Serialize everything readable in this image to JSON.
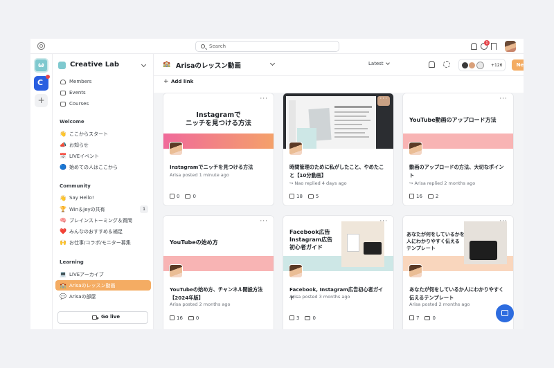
{
  "search": {
    "placeholder": "Search"
  },
  "notifications": {
    "badge": "1"
  },
  "community": {
    "name": "Creative Lab"
  },
  "sidebar": {
    "top_items": [
      {
        "label": "Members",
        "icon": "members-icon"
      },
      {
        "label": "Events",
        "icon": "calendar-icon"
      },
      {
        "label": "Courses",
        "icon": "book-icon"
      }
    ],
    "sections": [
      {
        "title": "Welcome",
        "items": [
          {
            "emoji": "👋",
            "label": "ここからスタート"
          },
          {
            "emoji": "📣",
            "label": "お知らせ"
          },
          {
            "emoji": "📅",
            "label": "LIVEイベント"
          },
          {
            "emoji": "🔵",
            "label": "始めての人はここから"
          }
        ]
      },
      {
        "title": "Community",
        "items": [
          {
            "emoji": "👋",
            "label": "Say Hello!"
          },
          {
            "emoji": "🏆",
            "label": "Win＆Jeyの共有",
            "count": "1"
          },
          {
            "emoji": "🧠",
            "label": "ブレインストーミング＆質問"
          },
          {
            "emoji": "❤️",
            "label": "みんなのおすすめ＆補足"
          },
          {
            "emoji": "🙌",
            "label": "お仕事/コラボ/モニター募集"
          }
        ]
      },
      {
        "title": "Learning",
        "items": [
          {
            "emoji": "💻",
            "label": "LIVEアーカイブ"
          },
          {
            "emoji": "🏫",
            "label": "Arisaのレッスン動画",
            "active": true
          },
          {
            "emoji": "💬",
            "label": "Arisaの部屋"
          }
        ]
      }
    ],
    "go_live": "Go live"
  },
  "main": {
    "space_emoji": "🏫",
    "space_title": "Arisaのレッスン動画",
    "sort": "Latest",
    "member_count": "+126",
    "new_post": "New post",
    "add_link": "Add link"
  },
  "posts": [
    {
      "cover_text": "Instagramで\nニッチを見つける方法",
      "title": "Instagramでニッチを見つける方法",
      "meta": "Arisa posted 1 minute ago",
      "likes": "0",
      "comments": "0"
    },
    {
      "cover_text": "",
      "title": "時間管理のために私がしたこと、やめたこと【10分動画】",
      "meta": "↪ Nao replied 4 days ago",
      "likes": "18",
      "comments": "5"
    },
    {
      "cover_text": "YouTube動画のアップロード方法",
      "title": "動画のアップロードの方法、大切なポイント",
      "meta": "↪ Arisa replied 2 months ago",
      "likes": "16",
      "comments": "2"
    },
    {
      "cover_text": "YouTubeの始め方",
      "title": "YouTubeの始め方、チャンネル開設方法【2024年版】",
      "meta": "Arisa posted 2 months ago",
      "likes": "16",
      "comments": "0"
    },
    {
      "cover_text": "Facebook広告\nInstagram広告\n初心者ガイド",
      "title": "Facebook, Instagram広告初心者ガイド",
      "meta": "Arisa posted 3 months ago",
      "likes": "3",
      "comments": "0"
    },
    {
      "cover_text": "あなたが何をしているかを\n人にわかりやすく伝える\nテンプレート",
      "title": "あなたが何をしているか人にわかりやすく伝えるテンプレート",
      "meta": "Arisa posted 2 months ago",
      "likes": "7",
      "comments": "0"
    }
  ],
  "colors": {
    "accent": "#f4ac63",
    "fab": "#2d6cdf",
    "pink": "#f08ab0",
    "salmon": "#f8b4b4"
  }
}
